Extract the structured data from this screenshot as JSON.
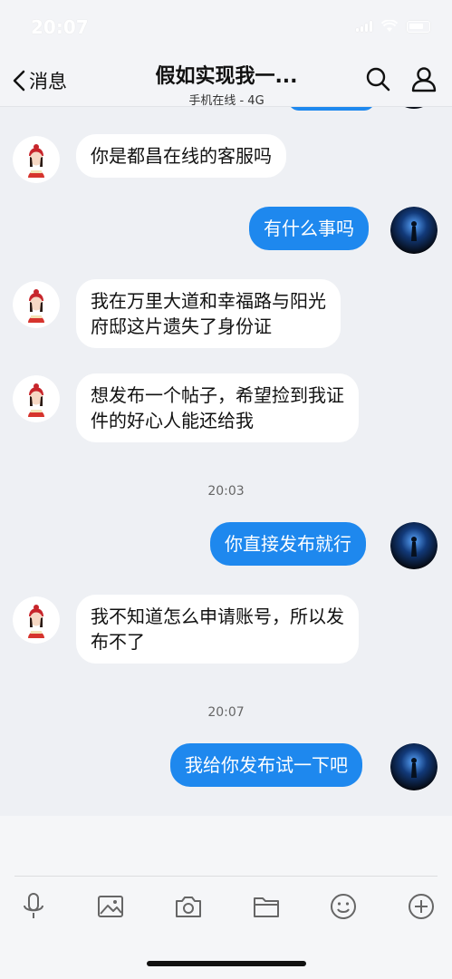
{
  "status_bar": {
    "time": "20:07"
  },
  "header": {
    "back_label": "消息",
    "title": "假如实现我一...",
    "subtitle": "手机在线 - 4G"
  },
  "messages": [
    {
      "type": "in",
      "text": "你是都昌在线的客服吗"
    },
    {
      "type": "out",
      "text": "有什么事吗"
    },
    {
      "type": "in",
      "lines": [
        "我在万里大道和幸福路与阳光",
        "府邸这片遗失了身份证"
      ]
    },
    {
      "type": "in",
      "lines": [
        "想发布一个帖子，希望捡到我证",
        "件的好心人能还给我"
      ]
    },
    {
      "type": "time",
      "text": "20:03"
    },
    {
      "type": "out",
      "text": "你直接发布就行"
    },
    {
      "type": "in",
      "lines": [
        "我不知道怎么申请账号，所以发",
        "布不了"
      ]
    },
    {
      "type": "time",
      "text": "20:07"
    },
    {
      "type": "out",
      "text": "我给你发布试一下吧"
    }
  ],
  "toolbar": {
    "icons": [
      "microphone-icon",
      "image-icon",
      "camera-icon",
      "folder-icon",
      "emoji-icon",
      "plus-icon"
    ]
  },
  "colors": {
    "outgoing_bubble": "#1e88ee",
    "background": "#eef0f4"
  }
}
